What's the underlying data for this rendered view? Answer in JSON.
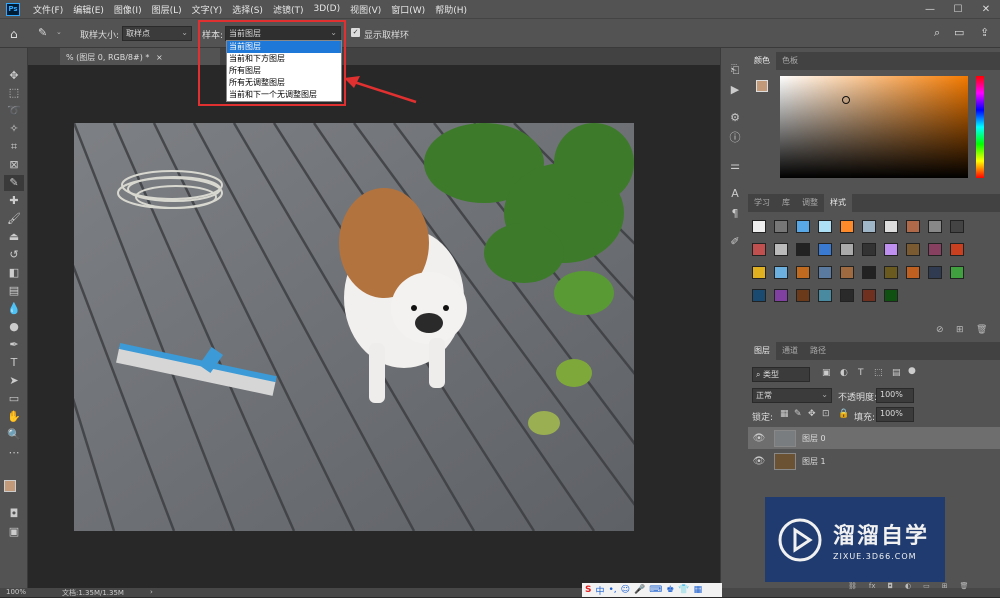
{
  "menubar": {
    "logo": "Ps",
    "items": [
      "文件(F)",
      "编辑(E)",
      "图像(I)",
      "图层(L)",
      "文字(Y)",
      "选择(S)",
      "滤镜(T)",
      "3D(D)",
      "视图(V)",
      "窗口(W)",
      "帮助(H)"
    ],
    "win_min": "—",
    "win_max": "☐",
    "win_close": "✕"
  },
  "options": {
    "sample_size_label": "取样大小:",
    "sample_size_value": "取样点",
    "sample_label": "样本:",
    "sample_value": "当前图层",
    "show_ring_label": "显示取样环"
  },
  "dropdown": {
    "options": [
      "当前图层",
      "当前和下方图层",
      "所有图层",
      "所有无调整图层",
      "当前和下一个无调整图层"
    ],
    "selected_index": 0
  },
  "document": {
    "tab_title": "% (图层 0, RGB/8#) *",
    "close": "×"
  },
  "status": {
    "zoom": "100%",
    "doc_info": "文档:1.35M/1.35M"
  },
  "color_panel": {
    "tabs": [
      "颜色",
      "色板"
    ],
    "fg_color": "#c29a7a"
  },
  "styles_panel": {
    "tabs": [
      "学习",
      "库",
      "调整",
      "样式"
    ]
  },
  "layers_panel": {
    "tabs": [
      "图层",
      "通道",
      "路径"
    ],
    "filter_kind": "类型",
    "blend_mode": "正常",
    "opacity_label": "不透明度:",
    "opacity_value": "100%",
    "lock_label": "锁定:",
    "fill_label": "填充:",
    "fill_value": "100%",
    "layers": [
      {
        "name": "图层 0",
        "selected": true
      },
      {
        "name": "图层 1",
        "selected": false
      }
    ]
  },
  "watermark": {
    "title": "溜溜自学",
    "url": "ZIXUE.3D66.COM"
  },
  "tray": {
    "ime_label": "中"
  }
}
